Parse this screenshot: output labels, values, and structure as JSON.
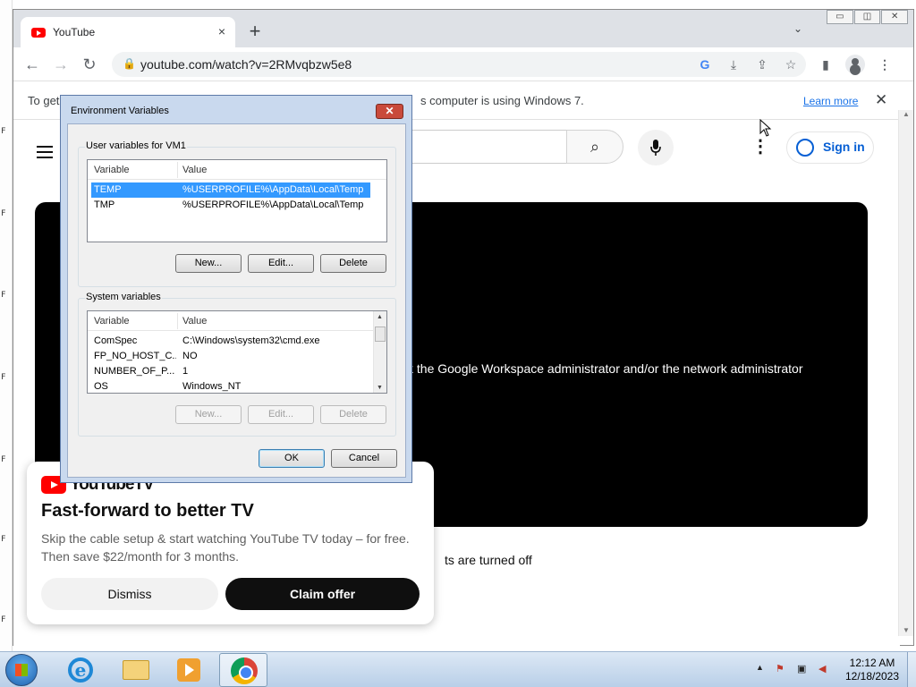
{
  "desktop": {
    "marks": [
      "F",
      "F",
      "F",
      "F",
      "F",
      "F",
      "F",
      "F",
      "F"
    ]
  },
  "browser": {
    "tab": {
      "title": "YouTube",
      "close": "×"
    },
    "new_tab": "+",
    "tab_search": "⌄",
    "window_buttons": [
      "▭",
      "◫",
      "✕"
    ],
    "nav": {
      "back": "←",
      "forward": "→",
      "reload": "↻"
    },
    "url": "youtube.com/watch?v=2RMvqbzw5e8",
    "toolbar_icons": {
      "google": "G",
      "install": "⤓",
      "share": "⇪",
      "bookmark": "☆",
      "sidepanel": "▮",
      "menu": "⋮"
    },
    "infobar": {
      "message_start": "To get",
      "message_end": "s computer is using Windows 7.",
      "learn_more": "Learn more",
      "close": "✕"
    }
  },
  "youtube": {
    "search_icon": "⌕",
    "mic_icon": "🎤",
    "more_icon": "⋮",
    "sign_in": "Sign in",
    "video_message": "k the Google Workspace administrator and/or the network administrator",
    "comments_message": "ts are turned off",
    "promo": {
      "logo_text": "YouTubeTV",
      "title": "Fast-forward to better TV",
      "body": "Skip the cable setup & start watching YouTube TV today – for free. Then save $22/month for 3 months.",
      "dismiss": "Dismiss",
      "claim": "Claim offer"
    }
  },
  "env_dialog": {
    "title": "Environment Variables",
    "close": "✕",
    "user_group": "User variables for VM1",
    "system_group": "System variables",
    "columns": [
      "Variable",
      "Value"
    ],
    "user_vars": [
      {
        "name": "TEMP",
        "value": "%USERPROFILE%\\AppData\\Local\\Temp",
        "selected": true
      },
      {
        "name": "TMP",
        "value": "%USERPROFILE%\\AppData\\Local\\Temp",
        "selected": false
      }
    ],
    "system_vars": [
      {
        "name": "ComSpec",
        "value": "C:\\Windows\\system32\\cmd.exe"
      },
      {
        "name": "FP_NO_HOST_C...",
        "value": "NO"
      },
      {
        "name": "NUMBER_OF_P...",
        "value": "1"
      },
      {
        "name": "OS",
        "value": "Windows_NT"
      }
    ],
    "buttons": {
      "new": "New...",
      "edit": "Edit...",
      "delete": "Delete",
      "ok": "OK",
      "cancel": "Cancel"
    },
    "scroll_up": "▲",
    "scroll_down": "▼"
  },
  "taskbar": {
    "tray_expand": "▲",
    "clock_time": "12:12 AM",
    "clock_date": "12/18/2023"
  }
}
